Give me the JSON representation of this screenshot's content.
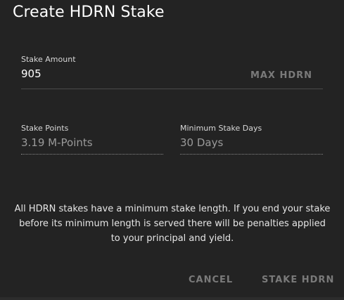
{
  "dialog": {
    "title": "Create HDRN Stake",
    "stake_amount": {
      "label": "Stake Amount",
      "value": "905",
      "max_label": "MAX HDRN"
    },
    "stake_points": {
      "label": "Stake Points",
      "value": "3.19 M-Points"
    },
    "min_stake_days": {
      "label": "Minimum Stake Days",
      "value": "30 Days"
    },
    "notice": "All HDRN stakes have a minimum stake length. If you end your stake before its minimum length is served there will be penalties applied to your principal and yield.",
    "actions": {
      "cancel_label": "CANCEL",
      "stake_label": "STAKE HDRN"
    }
  }
}
